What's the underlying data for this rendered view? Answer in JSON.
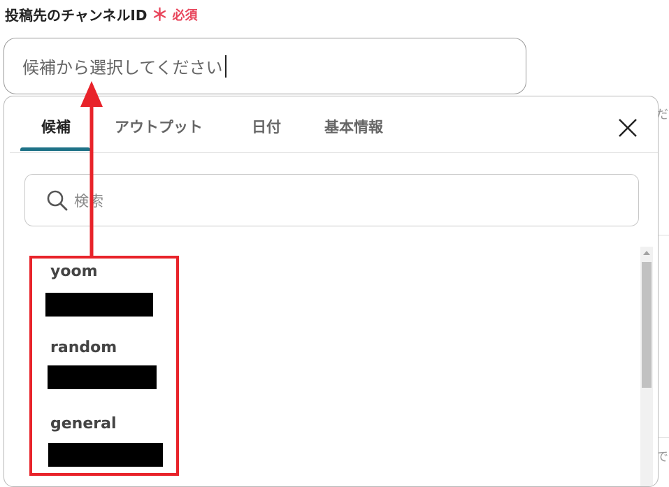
{
  "field": {
    "label": "投稿先のチャンネルID",
    "required_star": "＊",
    "required_text": "必須"
  },
  "select": {
    "placeholder": "候補から選択してください"
  },
  "panel": {
    "tabs": [
      {
        "label": "候補",
        "active": true
      },
      {
        "label": "アウトプット",
        "active": false
      },
      {
        "label": "日付",
        "active": false
      },
      {
        "label": "基本情報",
        "active": false
      }
    ],
    "search_placeholder": "検索",
    "items": [
      {
        "name": "yoom"
      },
      {
        "name": "random"
      },
      {
        "name": "general"
      }
    ]
  },
  "background_text": {
    "top_right": "だ",
    "bottom_right": "で"
  },
  "colors": {
    "required": "#e8455b",
    "tab_underline": "#1e7287",
    "annotation": "#e8232a"
  },
  "icons": {
    "search": "search-icon",
    "close": "close-icon"
  }
}
